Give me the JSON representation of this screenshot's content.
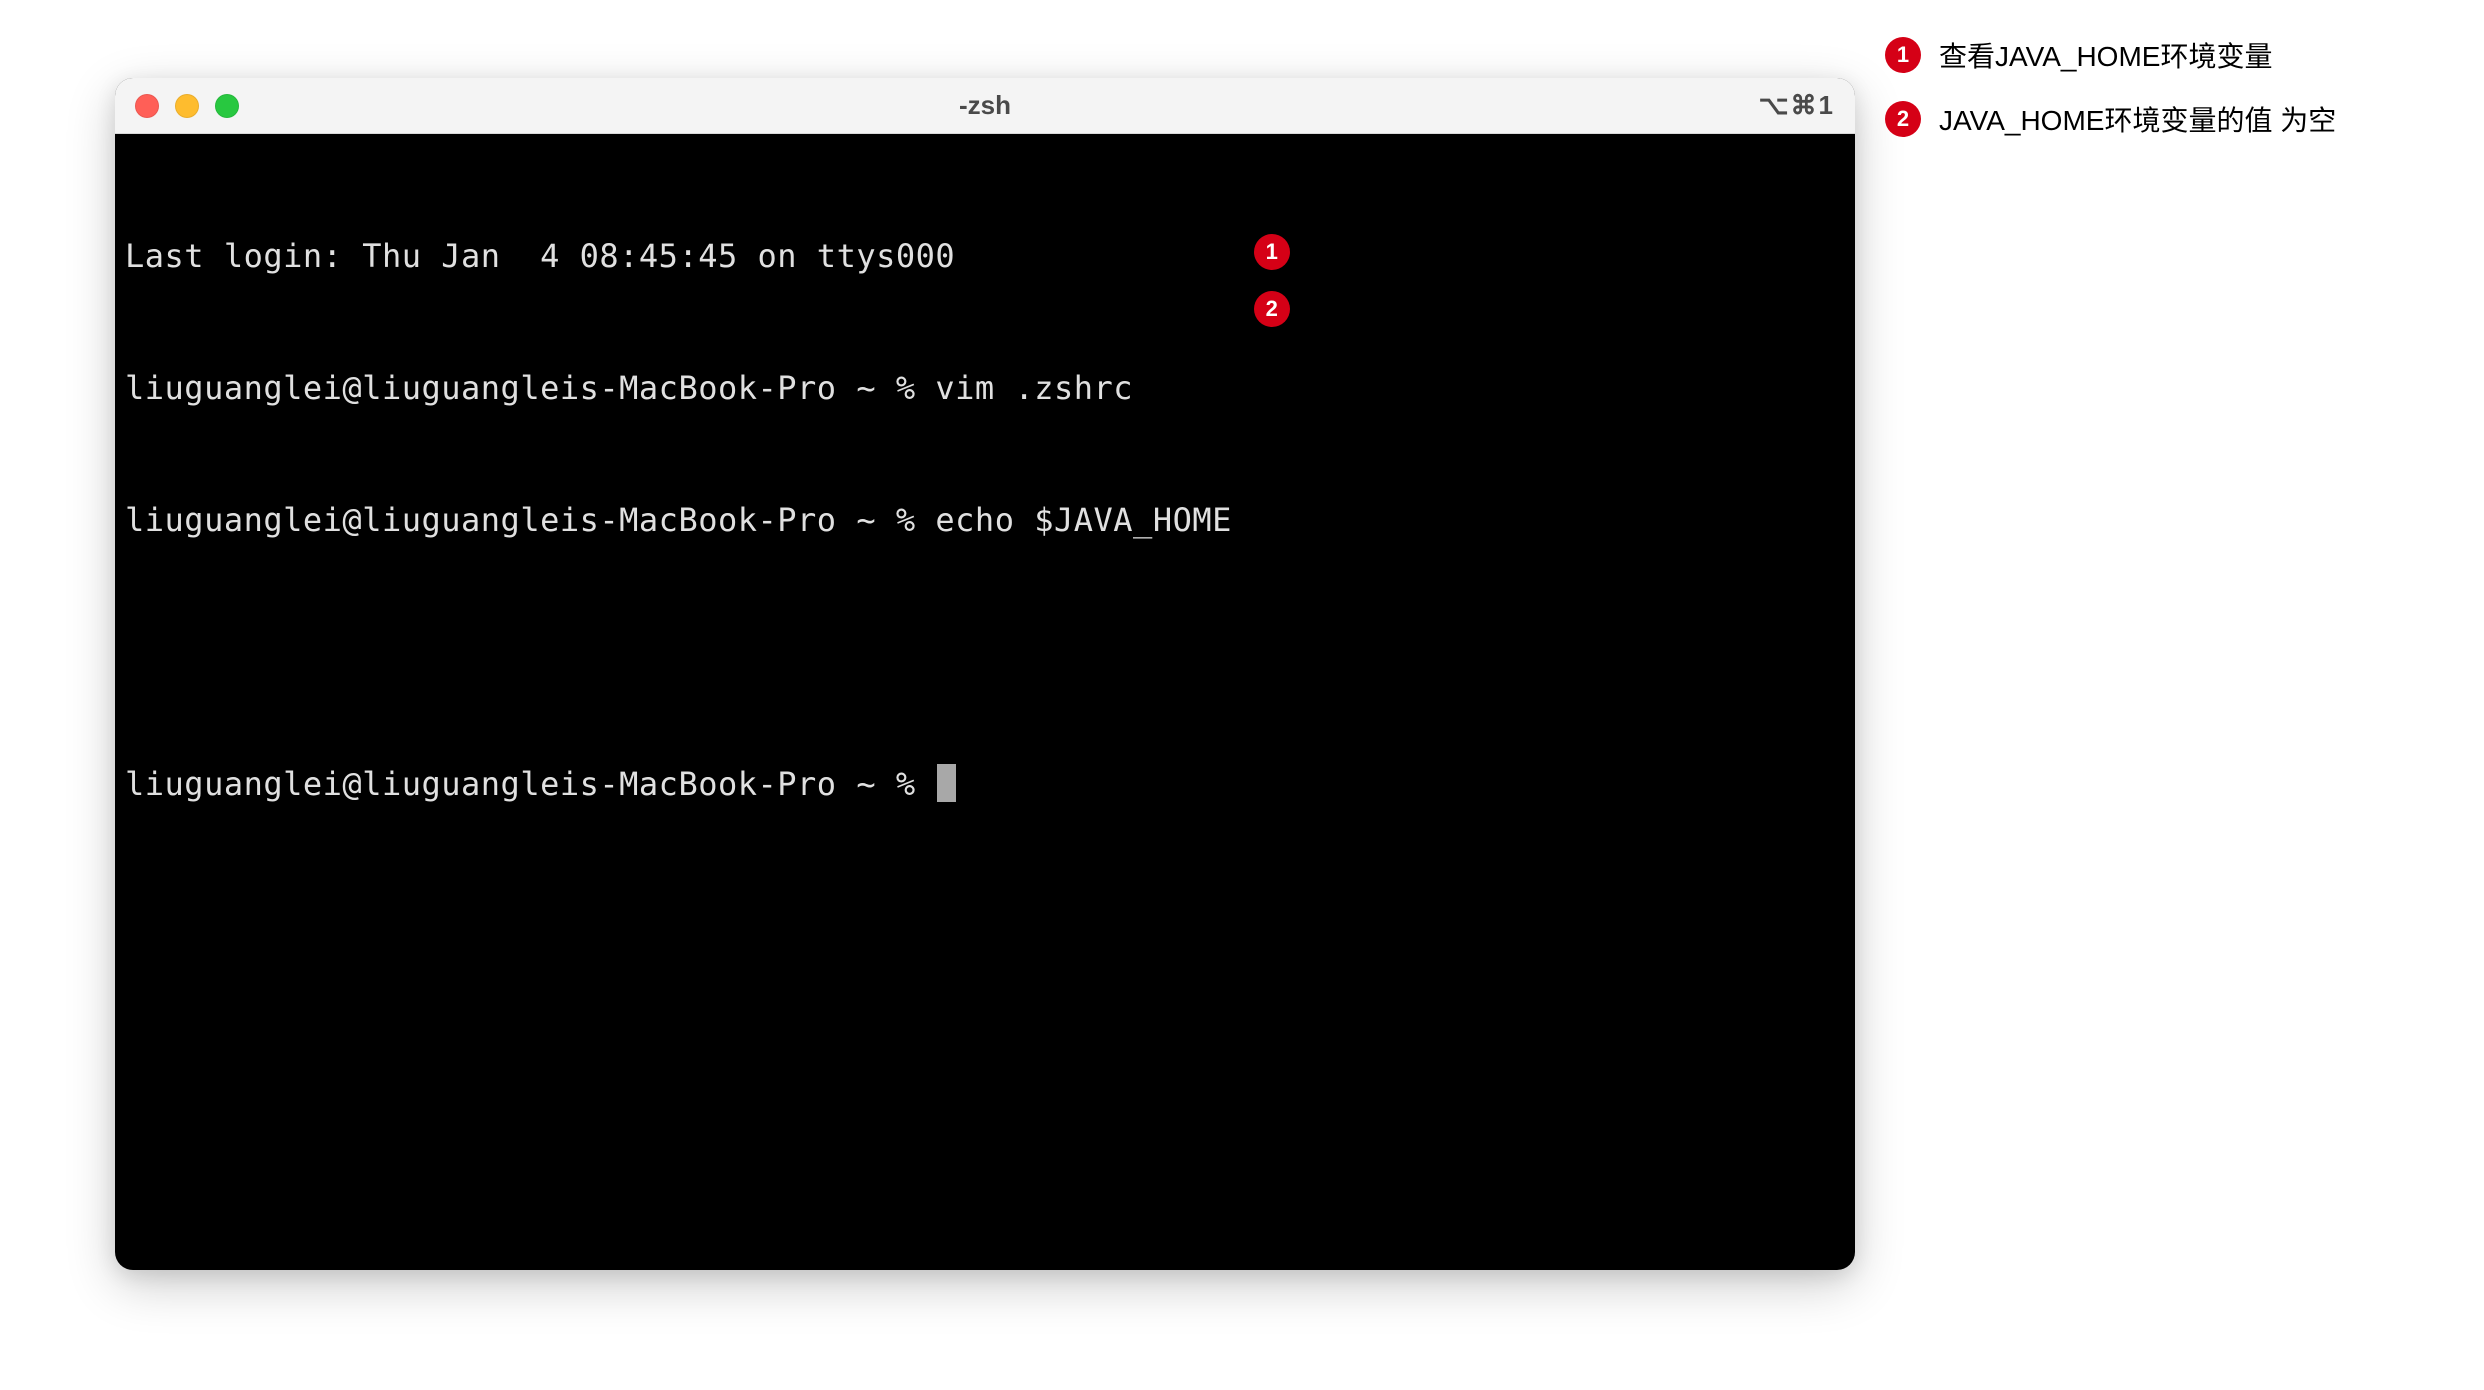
{
  "window": {
    "title": "-zsh",
    "shortcut": "⌥⌘1"
  },
  "terminal": {
    "lines": {
      "last_login": "Last login: Thu Jan  4 08:45:45 on ttys000",
      "prompt1": "liuguanglei@liuguangleis-MacBook-Pro ~ % ",
      "cmd1": "vim .zshrc",
      "prompt2": "liuguanglei@liuguangleis-MacBook-Pro ~ % ",
      "cmd2": "echo $JAVA_HOME",
      "blank": "",
      "prompt3": "liuguanglei@liuguangleis-MacBook-Pro ~ % "
    }
  },
  "annotations": [
    {
      "num": "1",
      "text": "查看JAVA_HOME环境变量"
    },
    {
      "num": "2",
      "text": "JAVA_HOME环境变量的值 为空"
    }
  ]
}
